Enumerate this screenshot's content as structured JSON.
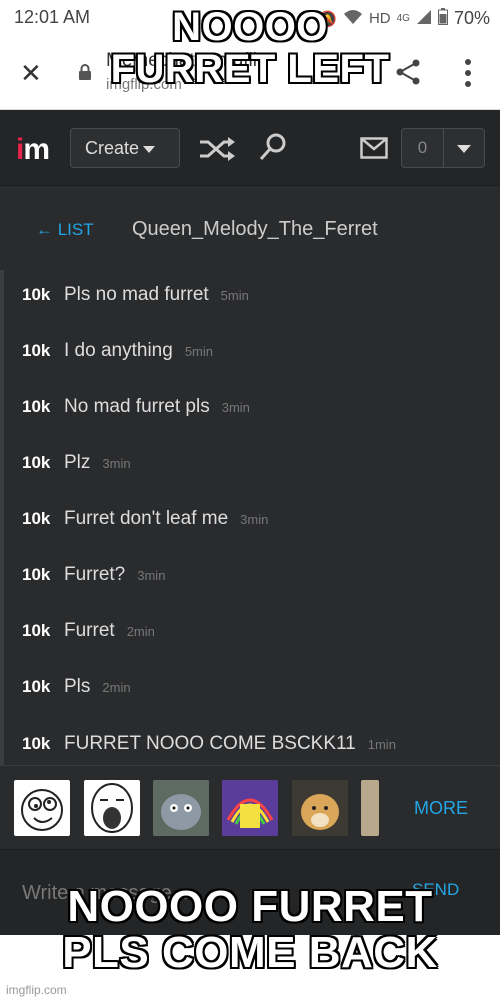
{
  "status_bar": {
    "time": "12:01 AM",
    "network": "HD",
    "signal_gen": "4G",
    "battery": "70%"
  },
  "browser": {
    "title": "Memechat - Imgflip",
    "url": "imgflip.com",
    "icons": [
      "close-icon",
      "lock-icon",
      "share-icon",
      "more-icon"
    ]
  },
  "nav": {
    "logo_i": "i",
    "logo_m": "m",
    "create_label": "Create",
    "notification_count": "0"
  },
  "chat": {
    "back_label": "← LIST",
    "username": "Queen_Melody_The_Ferret"
  },
  "messages": [
    {
      "badge": "10k",
      "text": "Pls no mad furret",
      "time": "5min"
    },
    {
      "badge": "10k",
      "text": "I do anything",
      "time": "5min"
    },
    {
      "badge": "10k",
      "text": "No mad furret pls",
      "time": "3min"
    },
    {
      "badge": "10k",
      "text": "Plz",
      "time": "3min"
    },
    {
      "badge": "10k",
      "text": "Furret don't leaf me",
      "time": "3min"
    },
    {
      "badge": "10k",
      "text": "Furret?",
      "time": "3min"
    },
    {
      "badge": "10k",
      "text": "Furret",
      "time": "2min"
    },
    {
      "badge": "10k",
      "text": "Pls",
      "time": "2min"
    },
    {
      "badge": "10k",
      "text": "FURRET NOOO COME BSCKK11",
      "time": "1min"
    }
  ],
  "meme_bar": {
    "more_label": "MORE",
    "thumbs": [
      "derp-meme",
      "lol-guy-meme",
      "tom-cat-meme",
      "imagination-spongebob-meme",
      "doge-meme",
      "partial-meme"
    ]
  },
  "compose": {
    "placeholder": "Write a message...",
    "send_label": "SEND"
  },
  "captions": {
    "top": "NOOOO FURRET LEFT",
    "bottom": "NOOOO FURRET PLS COME BACK"
  },
  "watermark": "imgflip.com",
  "colors": {
    "accent": "#23a6e6",
    "logo": "#e5234b",
    "background": "#2a2b2d"
  }
}
